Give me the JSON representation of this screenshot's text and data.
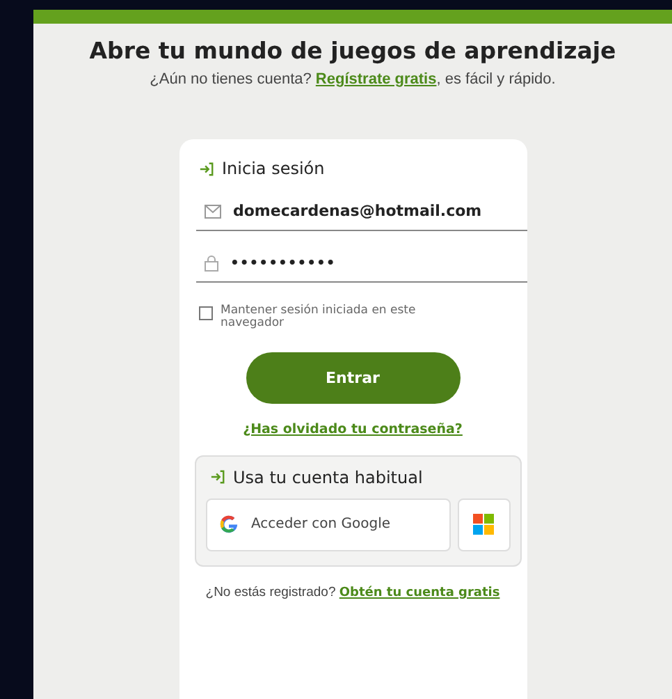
{
  "heading": "Abre tu mundo de juegos de aprendizaje",
  "subtitle": {
    "before": "¿Aún no tienes cuenta? ",
    "link": "Regístrate gratis",
    "after": ", es fácil y rápido."
  },
  "login": {
    "title": "Inicia sesión",
    "email": "domecardenas@hotmail.com",
    "password": "•••••••••••",
    "remember": {
      "label": "Mantener sesión iniciada en este navegador",
      "checked": false
    },
    "submit": "Entrar",
    "forgot": "¿Has olvidado tu contraseña?"
  },
  "social": {
    "title": "Usa tu cuenta habitual",
    "google": "Acceder con Google"
  },
  "footer": {
    "text": "¿No estás registrado? ",
    "link": "Obtén tu cuenta gratis"
  }
}
